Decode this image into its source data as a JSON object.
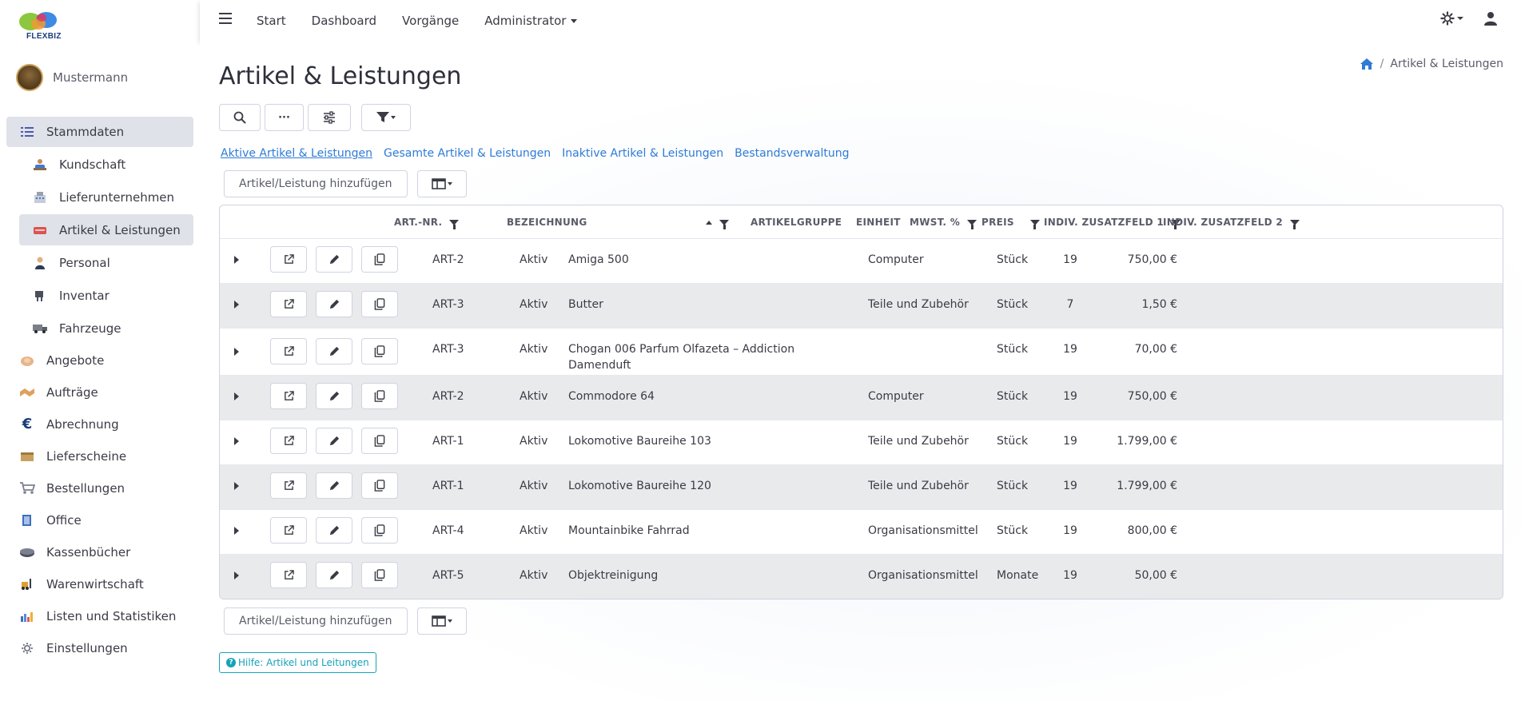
{
  "app": {
    "logo_text": "FLEXBIZ"
  },
  "user": {
    "name": "Mustermann"
  },
  "sidebar": {
    "items": [
      {
        "label": "Stammdaten",
        "icon": "list-icon",
        "level": "top",
        "active": true
      },
      {
        "label": "Kundschaft",
        "icon": "customers-icon",
        "level": "sub"
      },
      {
        "label": "Lieferunternehmen",
        "icon": "supplier-icon",
        "level": "sub"
      },
      {
        "label": "Artikel & Leistungen",
        "icon": "articles-icon",
        "level": "sub",
        "active": true
      },
      {
        "label": "Personal",
        "icon": "staff-icon",
        "level": "sub"
      },
      {
        "label": "Inventar",
        "icon": "inventory-icon",
        "level": "sub"
      },
      {
        "label": "Fahrzeuge",
        "icon": "vehicle-icon",
        "level": "sub"
      },
      {
        "label": "Angebote",
        "icon": "offer-icon",
        "level": "top"
      },
      {
        "label": "Aufträge",
        "icon": "handshake-icon",
        "level": "top"
      },
      {
        "label": "Abrechnung",
        "icon": "euro-icon",
        "level": "top"
      },
      {
        "label": "Lieferscheine",
        "icon": "delivery-icon",
        "level": "top"
      },
      {
        "label": "Bestellungen",
        "icon": "cart-icon",
        "level": "top"
      },
      {
        "label": "Office",
        "icon": "office-icon",
        "level": "top"
      },
      {
        "label": "Kassenbücher",
        "icon": "cashbook-icon",
        "level": "top"
      },
      {
        "label": "Warenwirtschaft",
        "icon": "forklift-icon",
        "level": "top"
      },
      {
        "label": "Listen und Statistiken",
        "icon": "chart-icon",
        "level": "top"
      },
      {
        "label": "Einstellungen",
        "icon": "settings-icon",
        "level": "top"
      }
    ]
  },
  "topbar": {
    "nav": [
      "Start",
      "Dashboard",
      "Vorgänge",
      "Administrator"
    ]
  },
  "page": {
    "title": "Artikel & Leistungen",
    "breadcrumb": "Artikel & Leistungen",
    "breadcrumb_sep": "/",
    "tabs": [
      "Aktive Artikel & Leistungen",
      "Gesamte Artikel & Leistungen",
      "Inaktive Artikel & Leistungen",
      "Bestandsverwaltung"
    ],
    "add_label": "Artikel/Leistung hinzufügen",
    "help_label": "Hilfe: Artikel und Leitungen",
    "toolbar_more": "···"
  },
  "table": {
    "headers": {
      "artnr": "Art.-Nr.",
      "bezeichnung": "Bezeichnung",
      "artikelgruppe": "Artikelgruppe",
      "einheit": "Einheit",
      "mwst": "MwSt. %",
      "preis": "Preis",
      "zusatz1": "Indiv. Zusatzfeld 1",
      "zusatz2": "Indiv. Zusatzfeld 2"
    },
    "rows": [
      {
        "artnr": "ART-2",
        "status": "Aktiv",
        "bezeichnung": "Amiga 500",
        "bezeichnung2": "",
        "gruppe": "Computer",
        "einheit": "Stück",
        "mwst": "19",
        "preis": "750,00 €"
      },
      {
        "artnr": "ART-3",
        "status": "Aktiv",
        "bezeichnung": "Butter",
        "bezeichnung2": "",
        "gruppe": "Teile und Zubehör",
        "einheit": "Stück",
        "mwst": "7",
        "preis": "1,50 €"
      },
      {
        "artnr": "ART-3",
        "status": "Aktiv",
        "bezeichnung": "Chogan 006 Parfum Olfazeta – Addiction",
        "bezeichnung2": "Damenduft",
        "gruppe": "",
        "einheit": "Stück",
        "mwst": "19",
        "preis": "70,00 €"
      },
      {
        "artnr": "ART-2",
        "status": "Aktiv",
        "bezeichnung": "Commodore 64",
        "bezeichnung2": "",
        "gruppe": "Computer",
        "einheit": "Stück",
        "mwst": "19",
        "preis": "750,00 €"
      },
      {
        "artnr": "ART-1",
        "status": "Aktiv",
        "bezeichnung": "Lokomotive Baureihe 103",
        "bezeichnung2": "",
        "gruppe": "Teile und Zubehör",
        "einheit": "Stück",
        "mwst": "19",
        "preis": "1.799,00 €"
      },
      {
        "artnr": "ART-1",
        "status": "Aktiv",
        "bezeichnung": "Lokomotive Baureihe 120",
        "bezeichnung2": "",
        "gruppe": "Teile und Zubehör",
        "einheit": "Stück",
        "mwst": "19",
        "preis": "1.799,00 €"
      },
      {
        "artnr": "ART-4",
        "status": "Aktiv",
        "bezeichnung": "Mountainbike Fahrrad",
        "bezeichnung2": "",
        "gruppe": "Organisationsmittel",
        "einheit": "Stück",
        "mwst": "19",
        "preis": "800,00 €"
      },
      {
        "artnr": "ART-5",
        "status": "Aktiv",
        "bezeichnung": "Objektreinigung",
        "bezeichnung2": "",
        "gruppe": "Organisationsmittel",
        "einheit": "Monate",
        "mwst": "19",
        "preis": "50,00 €"
      }
    ]
  },
  "colors": {
    "accent": "#2e7bd6",
    "help": "#17a2b8",
    "active_bg": "#dfe2e8",
    "row_alt": "#e9eaec"
  }
}
